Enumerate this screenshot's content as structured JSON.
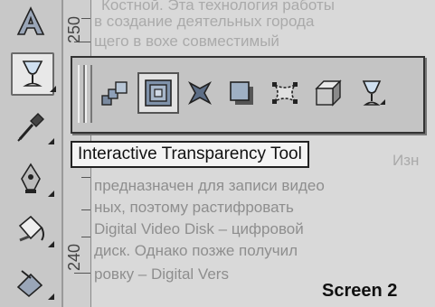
{
  "ruler": {
    "top_label": "250",
    "bottom_label": "240"
  },
  "toolbox": {
    "tools": [
      {
        "name": "text-tool",
        "icon": "letter-a-icon"
      },
      {
        "name": "interactive-transparency-tool",
        "icon": "wineglass-icon"
      },
      {
        "name": "eyedropper-tool",
        "icon": "eyedropper-icon"
      },
      {
        "name": "outline-pen-tool",
        "icon": "pen-nib-icon"
      },
      {
        "name": "fill-tool",
        "icon": "paint-bucket-icon"
      },
      {
        "name": "interactive-fill-tool",
        "icon": "interactive-fill-icon"
      }
    ]
  },
  "flyout": {
    "buttons": [
      {
        "name": "interactive-blend-tool",
        "icon": "blend-icon"
      },
      {
        "name": "interactive-contour-tool",
        "icon": "contour-icon"
      },
      {
        "name": "interactive-distortion-tool",
        "icon": "distortion-icon"
      },
      {
        "name": "interactive-drop-shadow-tool",
        "icon": "drop-shadow-icon"
      },
      {
        "name": "interactive-envelope-tool",
        "icon": "envelope-icon"
      },
      {
        "name": "interactive-extrude-tool",
        "icon": "extrude-icon"
      },
      {
        "name": "interactive-transparency-tool",
        "icon": "wineglass-icon"
      }
    ]
  },
  "tooltip": {
    "text": "Interactive Transparency Tool"
  },
  "caption": {
    "text": "Screen 2"
  },
  "background_text": {
    "lines": [
      "Костной. Эта технология работы",
      "в создание деятельных города",
      "щего в вохе совместимый",
      "Изн",
      "предназначен для записи видео",
      "ных, поэтому растифровать",
      "Digital Video Disk – цифровой",
      "диск. Однако позже получил",
      "ровку – Digital Vers"
    ]
  }
}
